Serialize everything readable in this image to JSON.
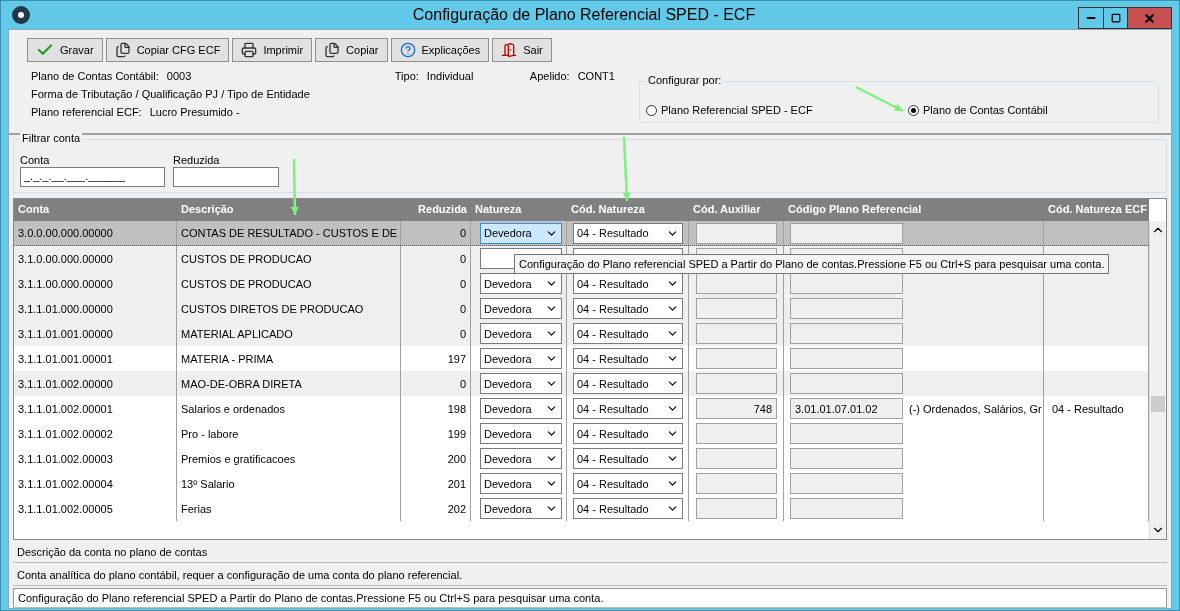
{
  "window": {
    "title": "Configuração de Plano Referencial SPED - ECF"
  },
  "toolbar": [
    {
      "kind": "save",
      "label": "Gravar"
    },
    {
      "kind": "copy_cfg",
      "label": "Copiar CFG ECF"
    },
    {
      "kind": "print",
      "label": "Imprimir"
    },
    {
      "kind": "copy",
      "label": "Copiar"
    },
    {
      "kind": "help",
      "label": "Explicações"
    },
    {
      "kind": "exit",
      "label": "Sair"
    }
  ],
  "info": {
    "plano_label": "Plano de Contas Contábil:",
    "plano_value": "0003",
    "tipo_label": "Tipo:",
    "tipo_value": "Individual",
    "apelido_label": "Apelido:",
    "apelido_value": "CONT1",
    "tributacao": "Forma de Tributação / Qualificação PJ / Tipo de Entidade",
    "referencial_label": "Plano referencial ECF:",
    "referencial_value": "Lucro Presumido -"
  },
  "configurar_por": {
    "title": "Configurar por:",
    "options": [
      {
        "label": "Plano Referencial SPED - ECF",
        "selected": false
      },
      {
        "label": "Plano de Contas Contábil",
        "selected": true
      }
    ]
  },
  "filtro": {
    "title": "Filtrar conta",
    "conta_label": "Conta",
    "conta_value": "_._._.__.___.______",
    "reduzida_label": "Reduzida"
  },
  "table": {
    "columns": [
      "Conta",
      "Descrição",
      "Reduzida",
      "Natureza",
      "Cód. Natureza",
      "Cód. Auxiliar",
      "Código Plano Referencial",
      "Cód. Natureza ECF"
    ],
    "rows": [
      {
        "kind": "sintetica",
        "selected": true,
        "conta": "3.0.0.00.000.00000",
        "descricao": "CONTAS DE RESULTADO - CUSTOS E DE",
        "reduzida": "0",
        "natureza": "Devedora",
        "cod_natureza": "04 - Resultado"
      },
      {
        "kind": "sintetica",
        "selected": false,
        "conta": "3.1.0.00.000.00000",
        "descricao": "CUSTOS DE PRODUCAO",
        "reduzida": "0"
      },
      {
        "kind": "sintetica",
        "selected": false,
        "conta": "3.1.1.00.000.00000",
        "descricao": "CUSTOS DE PRODUCAO",
        "reduzida": "0",
        "natureza": "Devedora",
        "cod_natureza": "04 - Resultado"
      },
      {
        "kind": "sintetica",
        "selected": false,
        "conta": "3.1.1.01.000.00000",
        "descricao": "CUSTOS DIRETOS DE PRODUCAO",
        "reduzida": "0",
        "natureza": "Devedora",
        "cod_natureza": "04 - Resultado"
      },
      {
        "kind": "sintetica",
        "selected": false,
        "conta": "3.1.1.01.001.00000",
        "descricao": "MATERIAL APLICADO",
        "reduzida": "0",
        "natureza": "Devedora",
        "cod_natureza": "04 - Resultado"
      },
      {
        "kind": "analitica",
        "selected": false,
        "conta": "3.1.1.01.001.00001",
        "descricao": "MATERIA - PRIMA",
        "reduzida": "197",
        "natureza": "Devedora",
        "cod_natureza": "04 - Resultado"
      },
      {
        "kind": "sintetica",
        "selected": false,
        "conta": "3.1.1.01.002.00000",
        "descricao": "MAO-DE-OBRA DIRETA",
        "reduzida": "0",
        "natureza": "Devedora",
        "cod_natureza": "04 - Resultado"
      },
      {
        "kind": "analitica",
        "selected": false,
        "conta": "3.1.1.01.002.00001",
        "descricao": "Salarios e ordenados",
        "reduzida": "198",
        "natureza": "Devedora",
        "cod_natureza": "04 - Resultado",
        "cod_auxiliar": "748",
        "codigo_referencial": "3.01.01.07.01.02",
        "referencial_descricao": "(-) Ordenados, Salários, Gr",
        "cod_natureza_ecf": "04 - Resultado"
      },
      {
        "kind": "analitica",
        "selected": false,
        "conta": "3.1.1.01.002.00002",
        "descricao": "Pro - labore",
        "reduzida": "199",
        "natureza": "Devedora",
        "cod_natureza": "04 - Resultado"
      },
      {
        "kind": "analitica",
        "selected": false,
        "conta": "3.1.1.01.002.00003",
        "descricao": "Premios e gratificacoes",
        "reduzida": "200",
        "natureza": "Devedora",
        "cod_natureza": "04 - Resultado"
      },
      {
        "kind": "analitica",
        "selected": false,
        "conta": "3.1.1.01.002.00004",
        "descricao": "13º Salario",
        "reduzida": "201",
        "natureza": "Devedora",
        "cod_natureza": "04 - Resultado"
      },
      {
        "kind": "analitica",
        "selected": false,
        "conta": "3.1.1.01.002.00005",
        "descricao": "Ferias",
        "reduzida": "202",
        "natureza": "Devedora",
        "cod_natureza": "04 - Resultado"
      }
    ]
  },
  "tooltip": "Configuração do Plano referencial SPED a Partir do Plano de contas.Pressione F5 ou Ctrl+S para pesquisar uma conta.",
  "status_lines": [
    "Descrição da conta no plano de contas",
    "Conta analítica do plano contábil, requer a configuração de uma conta do plano referencial."
  ],
  "hint_bar": "Configuração do Plano referencial SPED a Partir do Plano de contas.Pressione F5 ou Ctrl+S para pesquisar uma conta."
}
